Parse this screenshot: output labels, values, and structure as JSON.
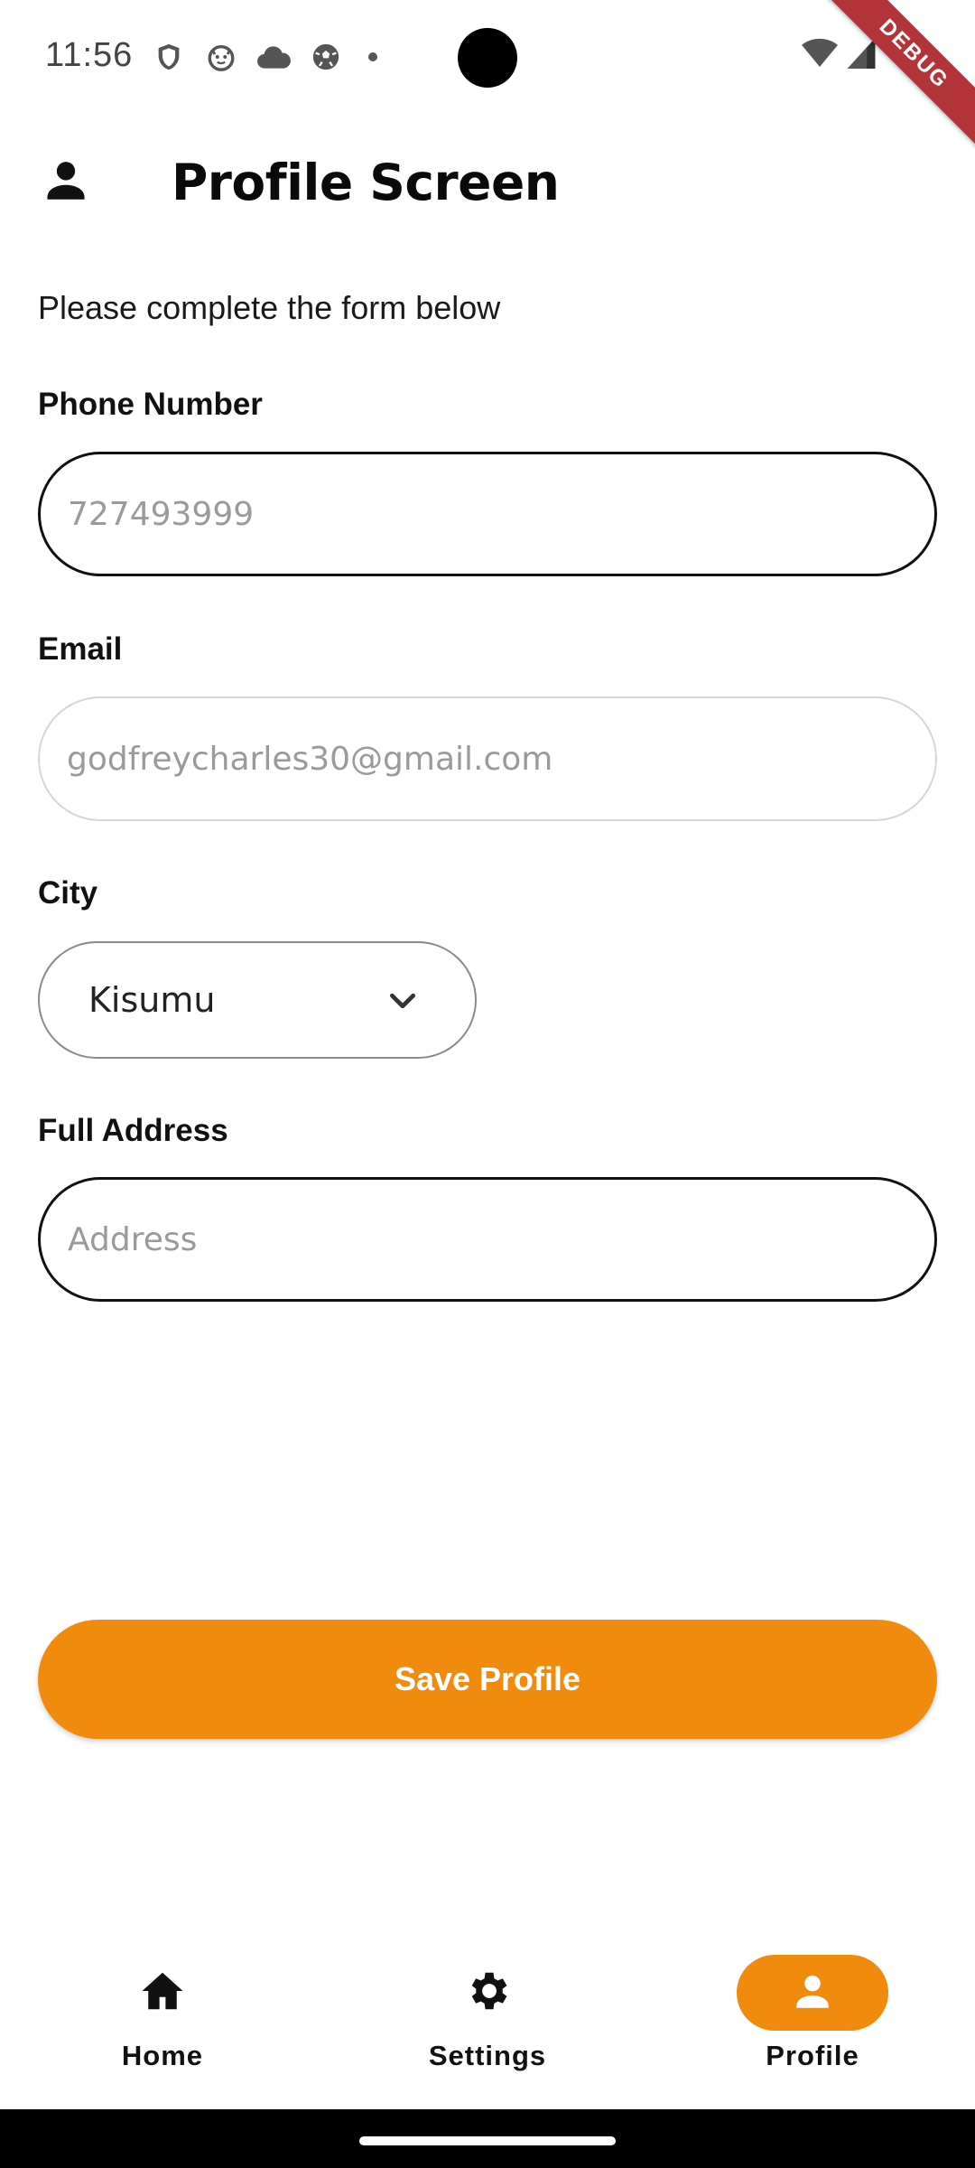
{
  "status_bar": {
    "time": "11:56",
    "left_icons": [
      "shield-icon",
      "cat-face-icon",
      "cloud-icon",
      "soccer-ball-icon",
      "dot-icon"
    ],
    "right_icons": [
      "wifi-icon",
      "cellular-signal-icon"
    ]
  },
  "debug_banner": "DEBUG",
  "app_bar": {
    "icon": "person-icon",
    "title": "Profile Screen"
  },
  "form": {
    "intro": "Please complete the form below",
    "phone": {
      "label": "Phone Number",
      "placeholder": "727493999"
    },
    "email": {
      "label": "Email",
      "placeholder": "godfreycharles30@gmail.com",
      "enabled": false
    },
    "city": {
      "label": "City",
      "selected": "Kisumu"
    },
    "address": {
      "label": "Full Address",
      "placeholder": "Address"
    },
    "save_label": "Save Profile"
  },
  "bottom_nav": {
    "items": [
      {
        "label": "Home",
        "icon": "home-icon",
        "active": false
      },
      {
        "label": "Settings",
        "icon": "gear-icon",
        "active": false
      },
      {
        "label": "Profile",
        "icon": "person-icon",
        "active": true
      }
    ]
  },
  "colors": {
    "accent": "#f08b0e",
    "debug_ribbon": "#b3353a",
    "text": "#111111"
  }
}
